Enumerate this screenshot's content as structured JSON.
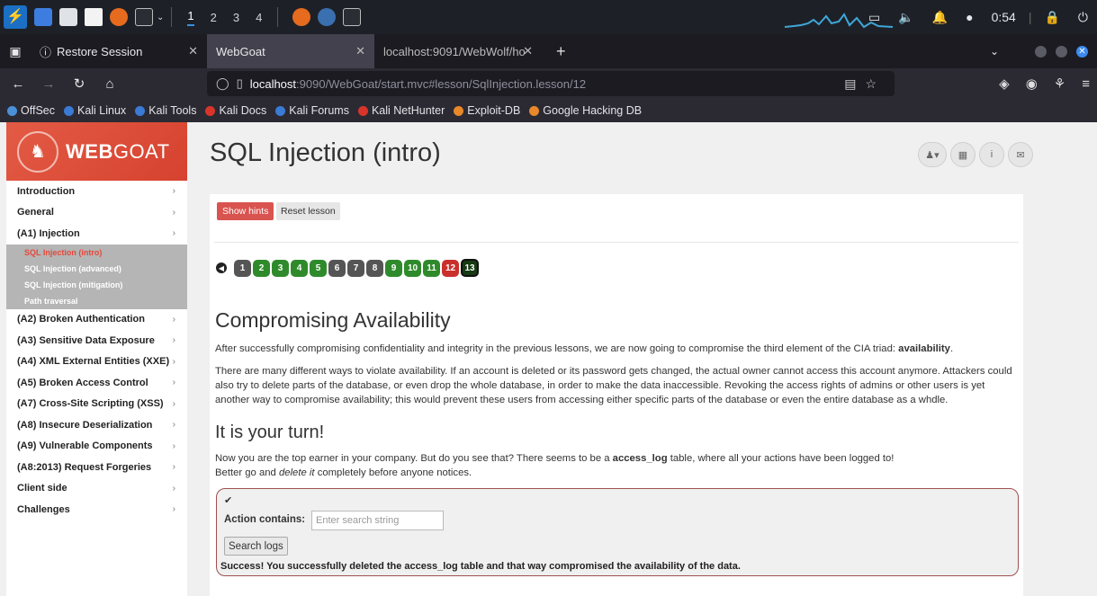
{
  "taskbar": {
    "workspaces": [
      "1",
      "2",
      "3",
      "4"
    ],
    "clock": "0:54"
  },
  "tabs": [
    {
      "label": "Restore Session",
      "icon": "info-icon"
    },
    {
      "label": "WebGoat",
      "active": true
    },
    {
      "label": "localhost:9091/WebWolf/ho"
    }
  ],
  "urlbar": {
    "host": "localhost",
    "rest": ":9090/WebGoat/start.mvc#lesson/SqlInjection.lesson/12"
  },
  "bookmarks": [
    {
      "label": "OffSec",
      "color": "#4a90d9"
    },
    {
      "label": "Kali Linux",
      "color": "#3a7bd5"
    },
    {
      "label": "Kali Tools",
      "color": "#3a7bd5"
    },
    {
      "label": "Kali Docs",
      "color": "#d9342b"
    },
    {
      "label": "Kali Forums",
      "color": "#3a7bd5"
    },
    {
      "label": "Kali NetHunter",
      "color": "#d9342b"
    },
    {
      "label": "Exploit-DB",
      "color": "#e8882a"
    },
    {
      "label": "Google Hacking DB",
      "color": "#e8882a"
    }
  ],
  "logo": {
    "bold": "WEB",
    "rest": "GOAT"
  },
  "page_title": "SQL Injection (intro)",
  "sidebar": {
    "items_top": [
      "Introduction",
      "General",
      "(A1) Injection"
    ],
    "subitems": [
      "SQL Injection (intro)",
      "SQL Injection (advanced)",
      "SQL Injection (mitigation)",
      "Path traversal"
    ],
    "items_bottom": [
      "(A2) Broken Authentication",
      "(A3) Sensitive Data Exposure",
      "(A4) XML External Entities (XXE)",
      "(A5) Broken Access Control",
      "(A7) Cross-Site Scripting (XSS)",
      "(A8) Insecure Deserialization",
      "(A9) Vulnerable Components",
      "(A8:2013) Request Forgeries",
      "Client side",
      "Challenges"
    ]
  },
  "lesson": {
    "show_hints": "Show hints",
    "reset_lesson": "Reset lesson",
    "pages": [
      {
        "n": "1",
        "state": "grey"
      },
      {
        "n": "2",
        "state": "green"
      },
      {
        "n": "3",
        "state": "green"
      },
      {
        "n": "4",
        "state": "green"
      },
      {
        "n": "5",
        "state": "green"
      },
      {
        "n": "6",
        "state": "grey"
      },
      {
        "n": "7",
        "state": "grey"
      },
      {
        "n": "8",
        "state": "grey"
      },
      {
        "n": "9",
        "state": "green"
      },
      {
        "n": "10",
        "state": "green"
      },
      {
        "n": "11",
        "state": "green"
      },
      {
        "n": "12",
        "state": "red"
      },
      {
        "n": "13",
        "state": "current"
      }
    ],
    "heading": "Compromising Availability",
    "p1_pre": "After successfully compromising confidentiality and integrity in the previous lessons, we are now going to compromise the third element of the CIA triad: ",
    "p1_bold": "availability",
    "p1_post": ".",
    "p2": "There are many different ways to violate availability. If an account is deleted or its password gets changed, the actual owner cannot access this account anymore. Attackers could also try to delete parts of the database, or even drop the whole database, in order to make the data inaccessible. Revoking the access rights of admins or other users is yet another way to compromise availability; this would prevent these users from accessing either specific parts of the database or even the entire database as a whdle.",
    "subheading": "It is your turn!",
    "p3_pre": "Now you are the top earner in your company. But do you see that? There seems to be a ",
    "p3_bold": "access_log",
    "p3_post": " table, where all your actions have been logged to!",
    "p4_pre": "Better go and ",
    "p4_em": "delete it",
    "p4_post": " completely before anyone notices.",
    "action_label": "Action contains:",
    "search_placeholder": "Enter search string",
    "search_button": "Search logs",
    "success": "Success! You successfully deleted the access_log table and that way compromised the availability of the data."
  }
}
